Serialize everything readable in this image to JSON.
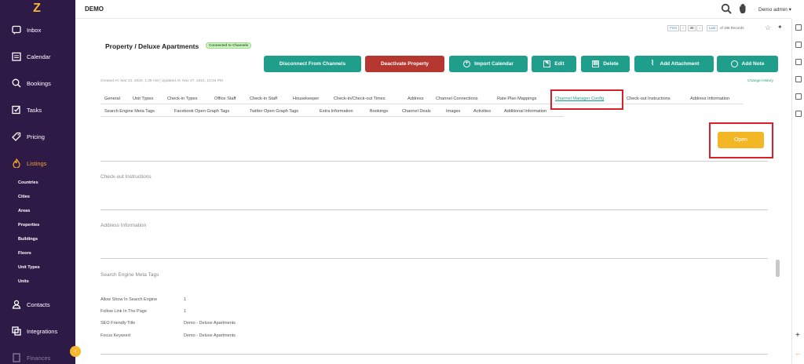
{
  "app": {
    "title": "DEMO",
    "user": "Demo admin"
  },
  "sidebar": {
    "items": [
      {
        "label": "Inbox",
        "icon": "inbox-icon"
      },
      {
        "label": "Calendar",
        "icon": "calendar-icon"
      },
      {
        "label": "Bookings",
        "icon": "bookings-icon"
      },
      {
        "label": "Tasks",
        "icon": "tasks-icon"
      },
      {
        "label": "Pricing",
        "icon": "tag-icon"
      },
      {
        "label": "Listings",
        "icon": "flame-icon"
      },
      {
        "label": "Contacts",
        "icon": "user-icon"
      },
      {
        "label": "Integrations",
        "icon": "integrations-icon"
      },
      {
        "label": "Finances",
        "icon": "finances-icon"
      }
    ],
    "sub_items": [
      "Countries",
      "Cities",
      "Areas",
      "Properties",
      "Buildings",
      "Floors",
      "Unit Types",
      "Units"
    ]
  },
  "pager": {
    "first": "First",
    "current": "38",
    "last": "Last",
    "total": "of 186 Records"
  },
  "page": {
    "breadcrumb": "Property / Deluxe Apartments",
    "badge": "Connected to Channels",
    "meta": "Created At: Mar 22, 2020, 1:35 AM | Updated At: Nov 27, 2021, 10:34 PM",
    "change_history": "Change History"
  },
  "actions": {
    "disconnect": "Disconnect From Channels",
    "deactivate": "Deactivate Property",
    "import": "Import Calendar",
    "edit": "Edit",
    "delete": "Delete",
    "attachment": "Add Attachment",
    "note": "Add Note"
  },
  "tabs_row1": [
    "General",
    "Unit Types",
    "Check-in Types",
    "Office Staff",
    "Check-in Staff",
    "Housekeeper",
    "Check-in/Check-out Times",
    "Address",
    "Channel Connections",
    "Rate Plan Mappings",
    "Channel Manager Config",
    "Check-out Instructions",
    "Address Information"
  ],
  "tabs_row2": [
    "Search Engine Meta Tags",
    "Facebook Open Graph Tags",
    "Twitter Open Graph Tags",
    "Extra Information",
    "Bookings",
    "Channel Deals",
    "Images",
    "Activities",
    "Additional Information"
  ],
  "active_tab": "Channel Manager Config",
  "open_button": "Open",
  "sections": {
    "checkout": "Check-out Instructions",
    "address": "Address Information",
    "seo": "Search Engine Meta Tags"
  },
  "seo_fields": [
    {
      "label": "Allow Show In Search Engine",
      "value": "1"
    },
    {
      "label": "Follow Link In The Page",
      "value": "1"
    },
    {
      "label": "SEO Friendly Title",
      "value": "Demo - Deluxe Apartments"
    },
    {
      "label": "Focus Keyword",
      "value": "Demo - Deluxe Apartments"
    }
  ],
  "colors": {
    "sidebar": "#2e1a47",
    "accent": "#1f9f8b",
    "danger": "#b5372f",
    "open": "#f3b624",
    "active_nav": "#f7a32b",
    "highlight": "#d8202a"
  }
}
